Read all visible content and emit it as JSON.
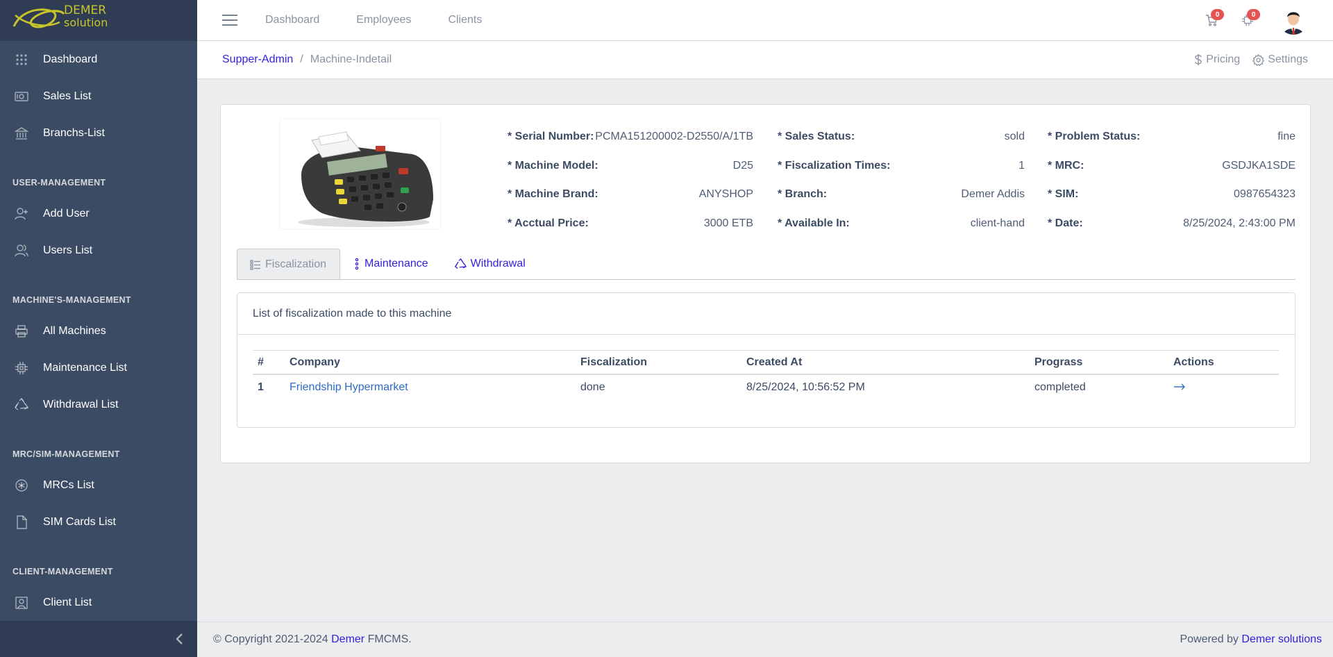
{
  "brand": {
    "name_top": "DEMER",
    "name_bottom": "solution"
  },
  "sidebar": {
    "items_top": [
      {
        "label": "Dashboard",
        "icon": "grid-dots-icon"
      },
      {
        "label": "Sales List",
        "icon": "cash-icon"
      },
      {
        "label": "Branchs-List",
        "icon": "bank-icon"
      }
    ],
    "sections": [
      {
        "title": "USER-MANAGEMENT",
        "items": [
          {
            "label": "Add User",
            "icon": "user-plus-icon"
          },
          {
            "label": "Users List",
            "icon": "users-icon"
          }
        ]
      },
      {
        "title": "MACHINE'S-MANAGEMENT",
        "items": [
          {
            "label": "All Machines",
            "icon": "printer-icon"
          },
          {
            "label": "Maintenance List",
            "icon": "chip-icon"
          },
          {
            "label": "Withdrawal List",
            "icon": "recycle-icon"
          }
        ]
      },
      {
        "title": "MRC/SIM-MANAGEMENT",
        "items": [
          {
            "label": "MRCs List",
            "icon": "asterisk-circle-icon"
          },
          {
            "label": "SIM Cards List",
            "icon": "file-icon"
          }
        ]
      },
      {
        "title": "CLIENT-MANAGEMENT",
        "items": [
          {
            "label": "Client List",
            "icon": "contact-icon"
          }
        ]
      }
    ]
  },
  "header": {
    "nav": [
      "Dashboard",
      "Employees",
      "Clients"
    ],
    "cart_count": "0",
    "notif_count": "0"
  },
  "subheader": {
    "breadcrumb_root": "Supper-Admin",
    "breadcrumb_separator": "/",
    "breadcrumb_current": "Machine-Indetail",
    "pricing": "Pricing",
    "settings": "Settings"
  },
  "machine": {
    "col1": [
      {
        "label": "* Serial Number:",
        "value": "PCMA151200002-D2550/A/1TB"
      },
      {
        "label": "* Machine Model:",
        "value": "D25"
      },
      {
        "label": "* Machine Brand:",
        "value": "ANYSHOP"
      },
      {
        "label": "* Acctual Price:",
        "value": "3000 ETB"
      }
    ],
    "col2": [
      {
        "label": "* Sales Status:",
        "value": "sold"
      },
      {
        "label": "* Fiscalization Times:",
        "value": "1"
      },
      {
        "label": "* Branch:",
        "value": "Demer Addis"
      },
      {
        "label": "* Available In:",
        "value": "client-hand"
      }
    ],
    "col3": [
      {
        "label": "* Problem Status:",
        "value": "fine"
      },
      {
        "label": "* MRC:",
        "value": "GSDJKA1SDE"
      },
      {
        "label": "* SIM:",
        "value": "0987654323"
      },
      {
        "label": "* Date:",
        "value": "8/25/2024, 2:43:00 PM"
      }
    ]
  },
  "tabs": [
    {
      "label": "Fiscalization",
      "icon": "list-icon",
      "active": true
    },
    {
      "label": "Maintenance",
      "icon": "vertical-dots-icon",
      "active": false
    },
    {
      "label": "Withdrawal",
      "icon": "recycle-icon",
      "active": false
    }
  ],
  "fiscalization": {
    "heading": "List of fiscalization made to this machine",
    "columns": [
      "#",
      "Company",
      "Fiscalization",
      "Created At",
      "Prograss",
      "Actions"
    ],
    "rows": [
      {
        "num": "1",
        "company": "Friendship Hypermarket",
        "fiscalization": "done",
        "created_at": "8/25/2024, 10:56:52 PM",
        "progress": "completed",
        "action_icon": "arrow-right-icon"
      }
    ]
  },
  "footer": {
    "copyright_prefix": "© Copyright 2021-2024",
    "copyright_link": "Demer",
    "copyright_suffix": "FMCMS.",
    "powered_by": "Powered by",
    "powered_link": "Demer solutions"
  },
  "colors": {
    "sidebar": "#3c4b64",
    "brand_bg": "#303c54",
    "primary": "#321fdb",
    "danger": "#e55353",
    "page_bg": "#ebedef"
  }
}
